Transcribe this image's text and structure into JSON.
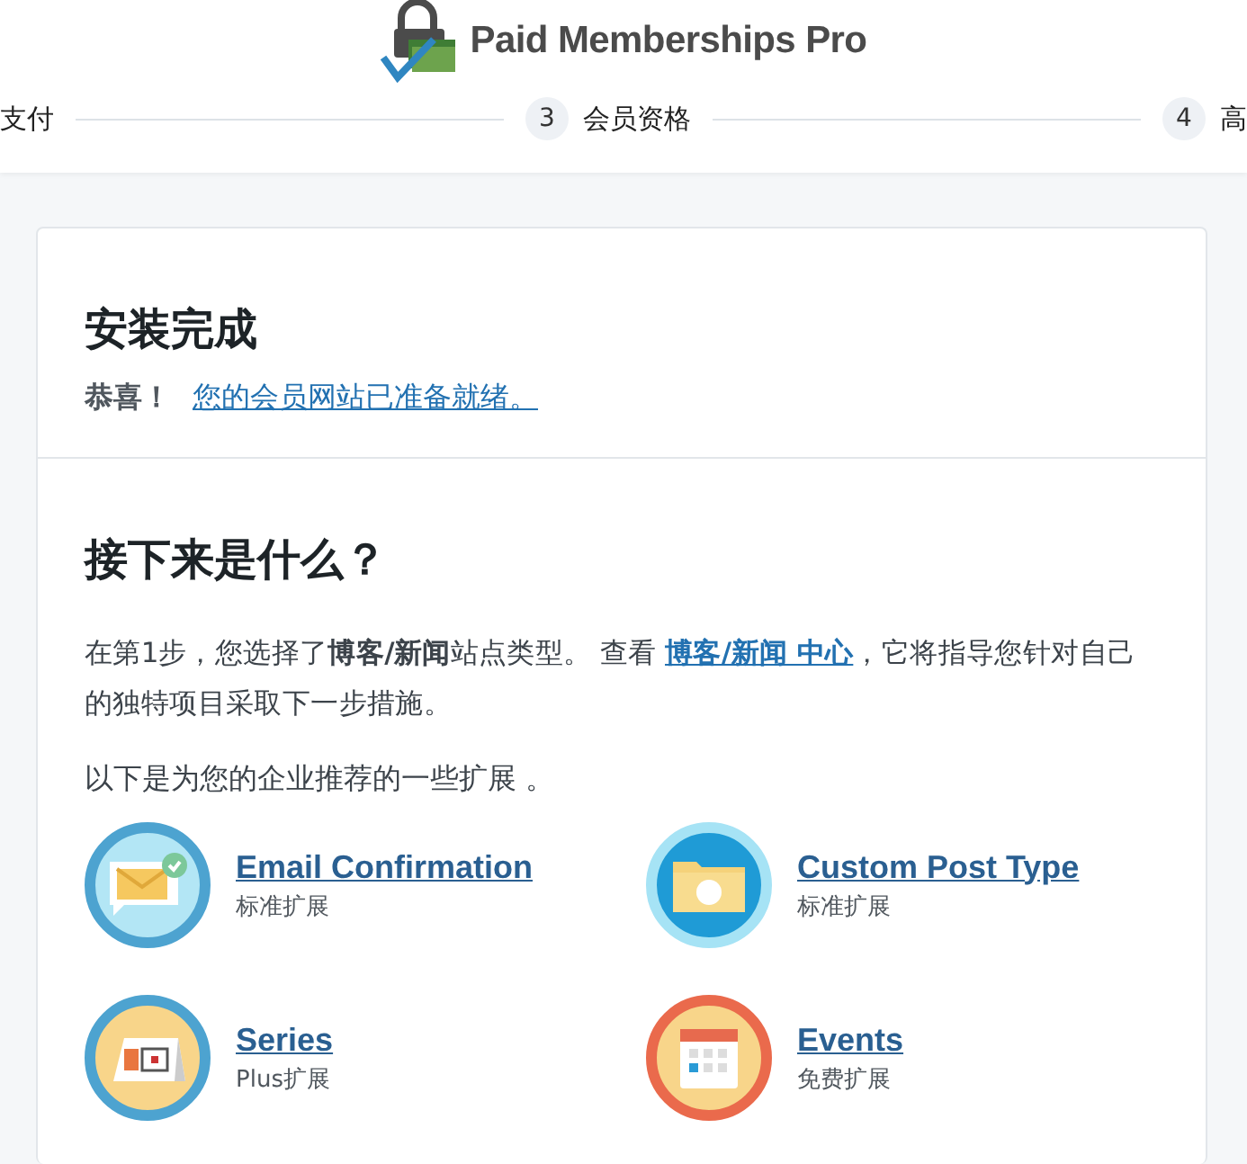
{
  "header": {
    "logo_text": "Paid Memberships Pro"
  },
  "steps": [
    {
      "label": "支付"
    },
    {
      "number": "3",
      "label": "会员资格"
    },
    {
      "number": "4",
      "label": "高"
    }
  ],
  "complete": {
    "title": "安装完成",
    "lead": "恭喜！",
    "link": "您的会员网站已准备就绪。"
  },
  "next": {
    "title": "接下来是什么？",
    "para_before": "在第1步，您选择了**博客/新闻**站点类型。 查看 ",
    "para_link": "博客/新闻 中心",
    "para_after": "，它将指导您针对自己的独特项目采取下一步措施。",
    "intro": "以下是为您的企业推荐的一些扩展 。"
  },
  "extensions": [
    {
      "name": "Email Confirmation",
      "tier": "标准扩展"
    },
    {
      "name": "Custom Post Type",
      "tier": "标准扩展"
    },
    {
      "name": "Series",
      "tier": "Plus扩展"
    },
    {
      "name": "Events",
      "tier": "免费扩展"
    }
  ]
}
